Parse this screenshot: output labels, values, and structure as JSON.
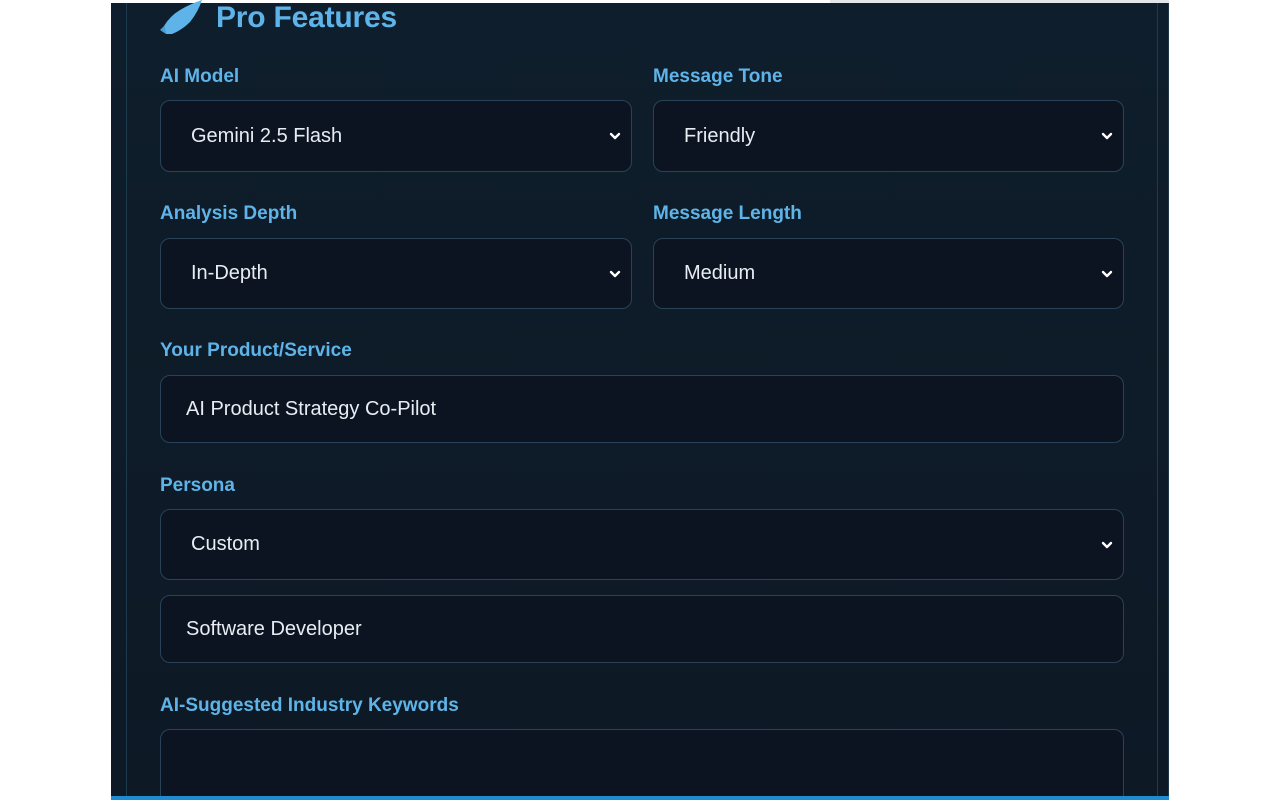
{
  "header": {
    "title": "Pro Features",
    "icon": "rocket-icon"
  },
  "fields": {
    "ai_model": {
      "label": "AI Model",
      "value": "Gemini 2.5 Flash"
    },
    "message_tone": {
      "label": "Message Tone",
      "value": "Friendly"
    },
    "analysis_depth": {
      "label": "Analysis Depth",
      "value": "In-Depth"
    },
    "message_length": {
      "label": "Message Length",
      "value": "Medium"
    },
    "product_service": {
      "label": "Your Product/Service",
      "value": "AI Product Strategy Co-Pilot"
    },
    "persona": {
      "label": "Persona",
      "value": "Custom",
      "custom_value": "Software Developer"
    },
    "keywords": {
      "label": "AI-Suggested Industry Keywords",
      "value": ""
    }
  },
  "colors": {
    "accent": "#5eb4e8",
    "panel_bg": "#0f1e2c",
    "field_bg": "#0b1420",
    "field_border": "#294257",
    "bottom_bar": "#1f8bd0"
  }
}
